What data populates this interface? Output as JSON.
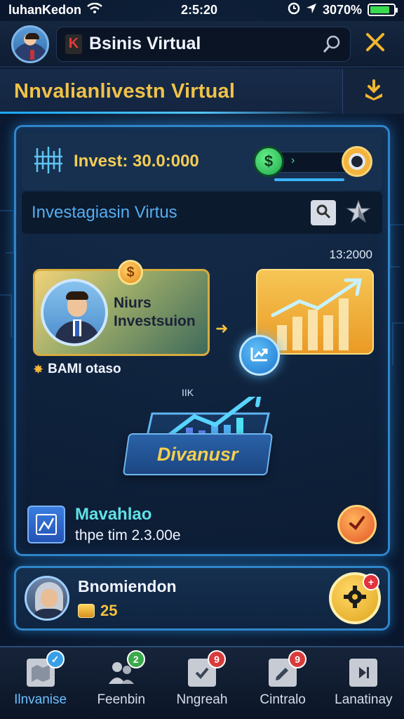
{
  "status_bar": {
    "carrier": "luhanKedon",
    "time": "2:5:20",
    "battery_percent": "3070%"
  },
  "header": {
    "app_title": "Bsinis Virtual"
  },
  "banner": {
    "title": "Nnvalianlivestn Virtual"
  },
  "invest": {
    "amount_label": "Invest: 30.0:000"
  },
  "sub_search": {
    "text": "Investagiasin Virtus"
  },
  "feed": {
    "timestamp": "13:2000",
    "profile_name_line1": "Niurs",
    "profile_name_line2": "Investsuion",
    "coin_symbol": "$",
    "badge_text": "BAMI otaso",
    "small_label": "IIK",
    "laptop_button": "Divanusr"
  },
  "activity": {
    "title": "Mavahlao",
    "subtitle": "thpe tim 2.3.00e"
  },
  "user_card": {
    "name": "Bnomiendon",
    "coins": "25",
    "notif_count": "+"
  },
  "bottom_nav": [
    {
      "label": "Ilnvanise",
      "badge": "✓",
      "badge_color": "#3aa0e6",
      "active": true
    },
    {
      "label": "Feenbin",
      "badge": "2",
      "badge_color": "#3aa94a",
      "active": false
    },
    {
      "label": "Nngreah",
      "badge": "9",
      "badge_color": "#d93b3b",
      "active": false
    },
    {
      "label": "Cintralo",
      "badge": "9",
      "badge_color": "#d93b3b",
      "active": false
    },
    {
      "label": "Lanatinay",
      "badge": "",
      "badge_color": "",
      "active": false
    }
  ],
  "colors": {
    "accent_gold": "#f0c248",
    "accent_blue": "#2f86c9",
    "background": "#0d1f37"
  },
  "icons": {
    "header_search": "search-icon",
    "header_close": "close-icon",
    "banner_download": "download-icon",
    "invest_circuit": "circuit-icon",
    "invest_toggle": "toggle-icon",
    "sub_magnifier": "magnifier-icon",
    "sub_star": "star-icon",
    "trend": "trend-up-icon",
    "activity_chart": "chart-icon",
    "activity_check": "check-icon",
    "user_gear": "gear-icon"
  }
}
